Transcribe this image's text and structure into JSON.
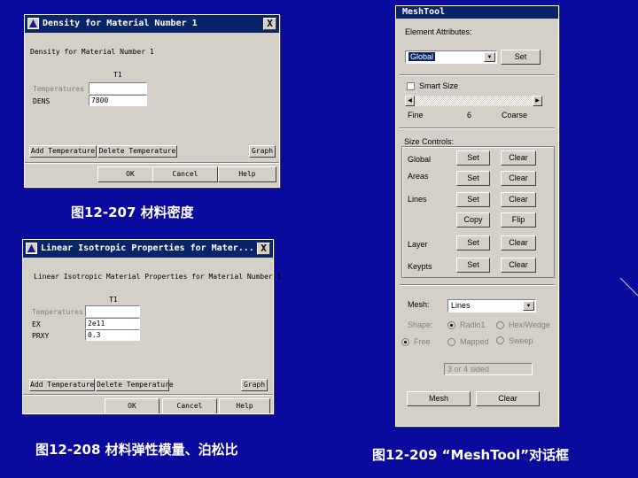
{
  "dialog1": {
    "title": "Density for Material Number 1",
    "heading": "Density for Material Number 1",
    "col_header": "T1",
    "temperatures_label": "Temperatures",
    "dens_label": "DENS",
    "dens_value": "7800",
    "temperature_value": "",
    "add_temp": "Add Temperature",
    "delete_temp": "Delete Temperature",
    "graph": "Graph",
    "ok": "OK",
    "cancel": "Cancel",
    "help": "Help",
    "close": "X"
  },
  "caption1": "图12-207 材料密度",
  "dialog2": {
    "title": "Linear Isotropic Properties for Mater...",
    "heading": "Linear Isotropic Material Properties for Material Number 1",
    "col_header": "T1",
    "temperatures_label": "Temperatures",
    "ex_label": "EX",
    "ex_value": "2e11",
    "prxy_label": "PRXY",
    "prxy_value": "0.3",
    "temperature_value": "",
    "add_temp": "Add Temperature",
    "delete_temp": "Delete Temperature",
    "graph": "Graph",
    "ok": "OK",
    "cancel": "Cancel",
    "help": "Help",
    "close": "X"
  },
  "caption2": "图12-208 材料弹性模量、泊松比",
  "meshtool": {
    "title": "MeshTool",
    "element_attributes": "Element Attributes:",
    "attr_select": "Global",
    "set": "Set",
    "smart_size": "Smart Size",
    "fine": "Fine",
    "smart_value": "6",
    "coarse": "Coarse",
    "size_controls": "Size Controls:",
    "rows": [
      {
        "label": "Global",
        "b1": "Set",
        "b2": "Clear"
      },
      {
        "label": "Areas",
        "b1": "Set",
        "b2": "Clear"
      },
      {
        "label": "Lines",
        "b1": "Set",
        "b2": "Clear"
      },
      {
        "label": "",
        "b1": "Copy",
        "b2": "Flip"
      },
      {
        "label": "Layer",
        "b1": "Set",
        "b2": "Clear"
      },
      {
        "label": "Keypts",
        "b1": "Set",
        "b2": "Clear"
      }
    ],
    "mesh_label": "Mesh:",
    "mesh_select": "Lines",
    "shape_label": "Shape:",
    "radio_tri": "Radio1",
    "radio_hex": "Hex/Wedge",
    "free": "Free",
    "mapped": "Mapped",
    "sweep": "Sweep",
    "sided_select": "3 or 4 sided",
    "mesh_button": "Mesh",
    "clear_button": "Clear"
  },
  "caption3": "图12-209 “MeshTool”对话框",
  "colors": {
    "background": "#0a0a9e",
    "titlebar": "#0a246a",
    "dialog": "#d4d0c8",
    "selection": "#0a246a"
  }
}
